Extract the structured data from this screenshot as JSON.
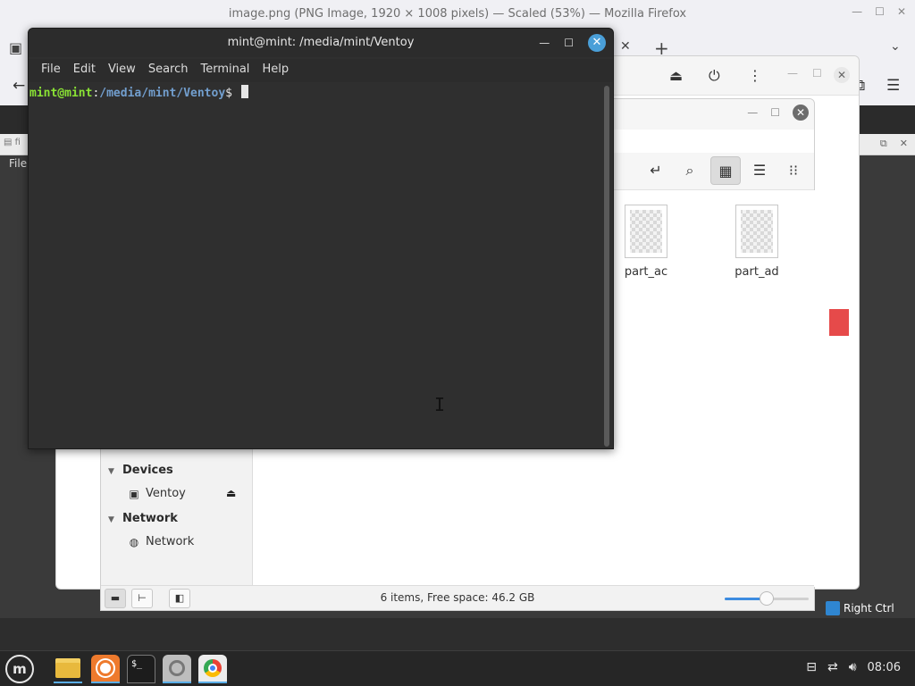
{
  "firefox": {
    "title": "image.png (PNG Image, 1920 × 1008 pixels) — Scaled (53%) — Mozilla Firefox"
  },
  "vm": {
    "menu_file": "File",
    "host_key": "Right Ctrl"
  },
  "terminal": {
    "title": "mint@mint: /media/mint/Ventoy",
    "menu": [
      "File",
      "Edit",
      "View",
      "Search",
      "Terminal",
      "Help"
    ],
    "prompt_user": "mint@mint",
    "prompt_sep": ":",
    "prompt_path": "/media/mint/Ventoy",
    "prompt_symbol": "$ "
  },
  "nemo": {
    "sidebar": {
      "devices_header": "Devices",
      "devices": [
        {
          "label": "Ventoy",
          "icon": "drive-icon"
        }
      ],
      "network_header": "Network",
      "network": [
        {
          "label": "Network",
          "icon": "globe-icon"
        }
      ]
    },
    "files": [
      {
        "name": "part_ac"
      },
      {
        "name": "part_ad"
      }
    ],
    "status_text": "6 items, Free space: 46.2 GB",
    "zoom_level": 0.5
  },
  "panel": {
    "clock": "08:06"
  },
  "colors": {
    "prompt_user": "#8ae234",
    "prompt_path": "#729fcf",
    "accent": "#4a9fd8"
  }
}
